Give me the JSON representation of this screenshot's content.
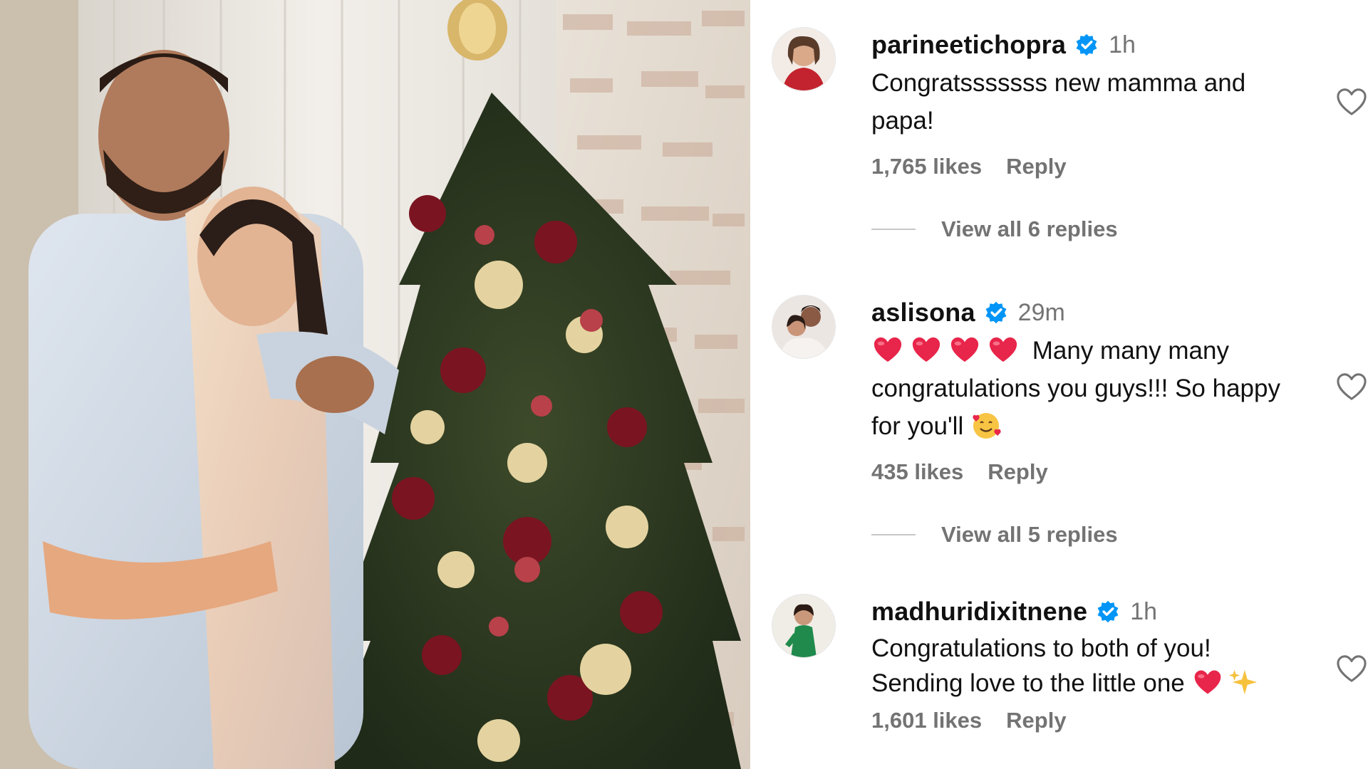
{
  "comments": [
    {
      "username": "parineetichopra",
      "verified": true,
      "time": "1h",
      "text": "Congratsssssss new mamma and papa!",
      "likes": "1,765 likes",
      "reply_label": "Reply",
      "view_replies": "View all 6 replies",
      "avatar_icon": "avatar-woman-red"
    },
    {
      "username": "aslisona",
      "verified": true,
      "time": "29m",
      "text_emoji_prefix": "heart-emoji x4",
      "text": "Many many many congratulations you guys!!! So happy for you'll",
      "text_emoji_suffix": "smiling-face-with-hearts-emoji",
      "likes": "435 likes",
      "reply_label": "Reply",
      "view_replies": "View all 5 replies",
      "avatar_icon": "avatar-couple"
    },
    {
      "username": "madhuridixitnene",
      "verified": true,
      "time": "1h",
      "text": "Congratulations to both of you! Sending love to the little one",
      "text_emoji_suffix": "heart-emoji sparkles-emoji",
      "likes": "1,601 likes",
      "reply_label": "Reply",
      "avatar_icon": "avatar-woman-green"
    }
  ],
  "colors": {
    "verified_blue": "#0095f6",
    "secondary_text": "#737373",
    "heart_red": "#e8254a"
  }
}
